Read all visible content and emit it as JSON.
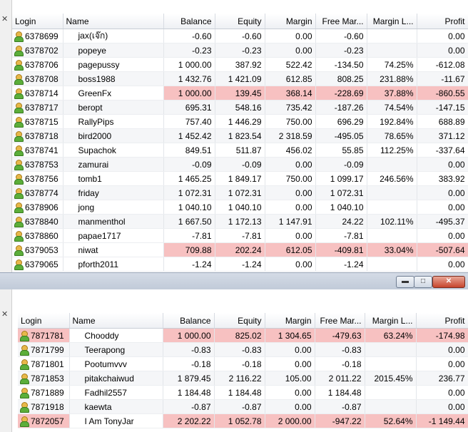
{
  "columns": [
    "Login",
    "Name",
    "Balance",
    "Equity",
    "Margin",
    "Free Mar...",
    "Margin L...",
    "Profit"
  ],
  "top_rows": [
    {
      "login": "6378699",
      "name": "jax(เจ๊ก)",
      "balance": "-0.60",
      "equity": "-0.60",
      "margin": "0.00",
      "free_margin": "-0.60",
      "margin_level": "",
      "profit": "0.00",
      "alert": false
    },
    {
      "login": "6378702",
      "name": "popeye",
      "balance": "-0.23",
      "equity": "-0.23",
      "margin": "0.00",
      "free_margin": "-0.23",
      "margin_level": "",
      "profit": "0.00",
      "alert": false
    },
    {
      "login": "6378706",
      "name": "pagepussy",
      "balance": "1 000.00",
      "equity": "387.92",
      "margin": "522.42",
      "free_margin": "-134.50",
      "margin_level": "74.25%",
      "profit": "-612.08",
      "alert": false
    },
    {
      "login": "6378708",
      "name": "boss1988",
      "balance": "1 432.76",
      "equity": "1 421.09",
      "margin": "612.85",
      "free_margin": "808.25",
      "margin_level": "231.88%",
      "profit": "-11.67",
      "alert": false
    },
    {
      "login": "6378714",
      "name": "GreenFx",
      "balance": "1 000.00",
      "equity": "139.45",
      "margin": "368.14",
      "free_margin": "-228.69",
      "margin_level": "37.88%",
      "profit": "-860.55",
      "alert": true
    },
    {
      "login": "6378717",
      "name": "beropt",
      "balance": "695.31",
      "equity": "548.16",
      "margin": "735.42",
      "free_margin": "-187.26",
      "margin_level": "74.54%",
      "profit": "-147.15",
      "alert": false
    },
    {
      "login": "6378715",
      "name": "RallyPips",
      "balance": "757.40",
      "equity": "1 446.29",
      "margin": "750.00",
      "free_margin": "696.29",
      "margin_level": "192.84%",
      "profit": "688.89",
      "alert": false
    },
    {
      "login": "6378718",
      "name": "bird2000",
      "balance": "1 452.42",
      "equity": "1 823.54",
      "margin": "2 318.59",
      "free_margin": "-495.05",
      "margin_level": "78.65%",
      "profit": "371.12",
      "alert": false
    },
    {
      "login": "6378741",
      "name": "Supachok",
      "balance": "849.51",
      "equity": "511.87",
      "margin": "456.02",
      "free_margin": "55.85",
      "margin_level": "112.25%",
      "profit": "-337.64",
      "alert": false
    },
    {
      "login": "6378753",
      "name": "zamurai",
      "balance": "-0.09",
      "equity": "-0.09",
      "margin": "0.00",
      "free_margin": "-0.09",
      "margin_level": "",
      "profit": "0.00",
      "alert": false
    },
    {
      "login": "6378756",
      "name": "tomb1",
      "balance": "1 465.25",
      "equity": "1 849.17",
      "margin": "750.00",
      "free_margin": "1 099.17",
      "margin_level": "246.56%",
      "profit": "383.92",
      "alert": false
    },
    {
      "login": "6378774",
      "name": "friday",
      "balance": "1 072.31",
      "equity": "1 072.31",
      "margin": "0.00",
      "free_margin": "1 072.31",
      "margin_level": "",
      "profit": "0.00",
      "alert": false
    },
    {
      "login": "6378906",
      "name": "jong",
      "balance": "1 040.10",
      "equity": "1 040.10",
      "margin": "0.00",
      "free_margin": "1 040.10",
      "margin_level": "",
      "profit": "0.00",
      "alert": false
    },
    {
      "login": "6378840",
      "name": "manmenthol",
      "balance": "1 667.50",
      "equity": "1 172.13",
      "margin": "1 147.91",
      "free_margin": "24.22",
      "margin_level": "102.11%",
      "profit": "-495.37",
      "alert": false
    },
    {
      "login": "6378860",
      "name": "papae1717",
      "balance": "-7.81",
      "equity": "-7.81",
      "margin": "0.00",
      "free_margin": "-7.81",
      "margin_level": "",
      "profit": "0.00",
      "alert": false
    },
    {
      "login": "6379053",
      "name": "niwat",
      "balance": "709.88",
      "equity": "202.24",
      "margin": "612.05",
      "free_margin": "-409.81",
      "margin_level": "33.04%",
      "profit": "-507.64",
      "alert": true
    },
    {
      "login": "6379065",
      "name": "pforth2011",
      "balance": "-1.24",
      "equity": "-1.24",
      "margin": "0.00",
      "free_margin": "-1.24",
      "margin_level": "",
      "profit": "0.00",
      "alert": false
    }
  ],
  "bottom_rows": [
    {
      "login": "7871781",
      "name": "Chooddy",
      "balance": "1 000.00",
      "equity": "825.02",
      "margin": "1 304.65",
      "free_margin": "-479.63",
      "margin_level": "63.24%",
      "profit": "-174.98",
      "alert": true
    },
    {
      "login": "7871799",
      "name": "Teerapong",
      "balance": "-0.83",
      "equity": "-0.83",
      "margin": "0.00",
      "free_margin": "-0.83",
      "margin_level": "",
      "profit": "0.00",
      "alert": false
    },
    {
      "login": "7871801",
      "name": "Pootumvvv",
      "balance": "-0.18",
      "equity": "-0.18",
      "margin": "0.00",
      "free_margin": "-0.18",
      "margin_level": "",
      "profit": "0.00",
      "alert": false
    },
    {
      "login": "7871853",
      "name": "pitakchaiwud",
      "balance": "1 879.45",
      "equity": "2 116.22",
      "margin": "105.00",
      "free_margin": "2 011.22",
      "margin_level": "2015.45%",
      "profit": "236.77",
      "alert": false
    },
    {
      "login": "7871889",
      "name": "Fadhil2557",
      "balance": "1 184.48",
      "equity": "1 184.48",
      "margin": "0.00",
      "free_margin": "1 184.48",
      "margin_level": "",
      "profit": "0.00",
      "alert": false
    },
    {
      "login": "7871918",
      "name": "kaewta",
      "balance": "-0.87",
      "equity": "-0.87",
      "margin": "0.00",
      "free_margin": "-0.87",
      "margin_level": "",
      "profit": "0.00",
      "alert": false
    },
    {
      "login": "7872057",
      "name": "I Am TonyJar",
      "balance": "2 202.22",
      "equity": "1 052.78",
      "margin": "2 000.00",
      "free_margin": "-947.22",
      "margin_level": "52.64%",
      "profit": "-1 149.44",
      "alert": true
    }
  ],
  "window_buttons": {
    "minimize": "▬",
    "maximize": "□",
    "close": "✕"
  },
  "icons": {
    "user": "user-icon",
    "close": "close-icon"
  },
  "colors": {
    "alert_row": "#f7c1c1",
    "header": "#eef0f4",
    "titlebar": "#c0cad8"
  }
}
